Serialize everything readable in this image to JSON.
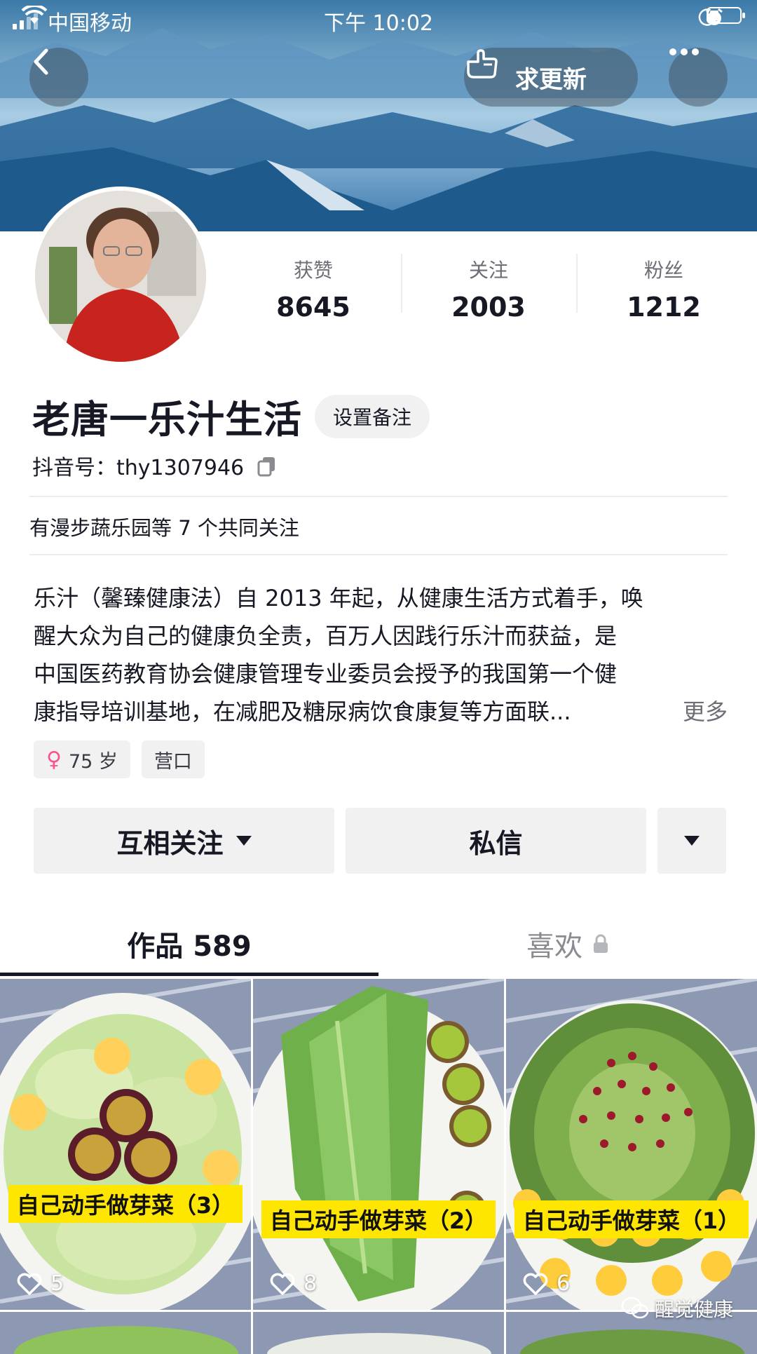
{
  "status_bar": {
    "carrier": "中国移动",
    "time": "下午 10:02"
  },
  "header": {
    "request_update_label": "求更新"
  },
  "profile": {
    "stats": [
      {
        "label": "获赞",
        "value": "8645"
      },
      {
        "label": "关注",
        "value": "2003"
      },
      {
        "label": "粉丝",
        "value": "1212"
      }
    ],
    "name": "老唐一乐汁生活",
    "remark_button": "设置备注",
    "douyin_id": "抖音号：thy1307946",
    "mutual_follow": "有漫步蔬乐园等 7 个共同关注",
    "bio_lines": [
      "乐汁（馨臻健康法）自 2013 年起，从健康生活方式着手，唤",
      "醒大众为自己的健康负全责，百万人因践行乐汁而获益，是",
      "中国医药教育协会健康管理专业委员会授予的我国第一个健",
      "康指导培训基地，在减肥及糖尿病饮食康复等方面联..."
    ],
    "bio_more": "更多",
    "tags": {
      "age": "75 岁",
      "location": "营口"
    }
  },
  "actions": {
    "follow_label": "互相关注",
    "message_label": "私信"
  },
  "tabs": {
    "works_label": "作品 589",
    "likes_label": "喜欢"
  },
  "videos": [
    {
      "caption": "自己动手做芽菜（3）",
      "likes": "5"
    },
    {
      "caption": "自己动手做芽菜（2）",
      "likes": "8"
    },
    {
      "caption": "自己动手做芽菜（1）",
      "likes": "6"
    }
  ],
  "watermark": "醒觉健康",
  "colors": {
    "text_primary": "#161823",
    "text_secondary": "#6d6e75",
    "button_bg": "#f1f1f2",
    "caption_yellow": "#ffe600",
    "female_pink": "#ff4f8f"
  }
}
